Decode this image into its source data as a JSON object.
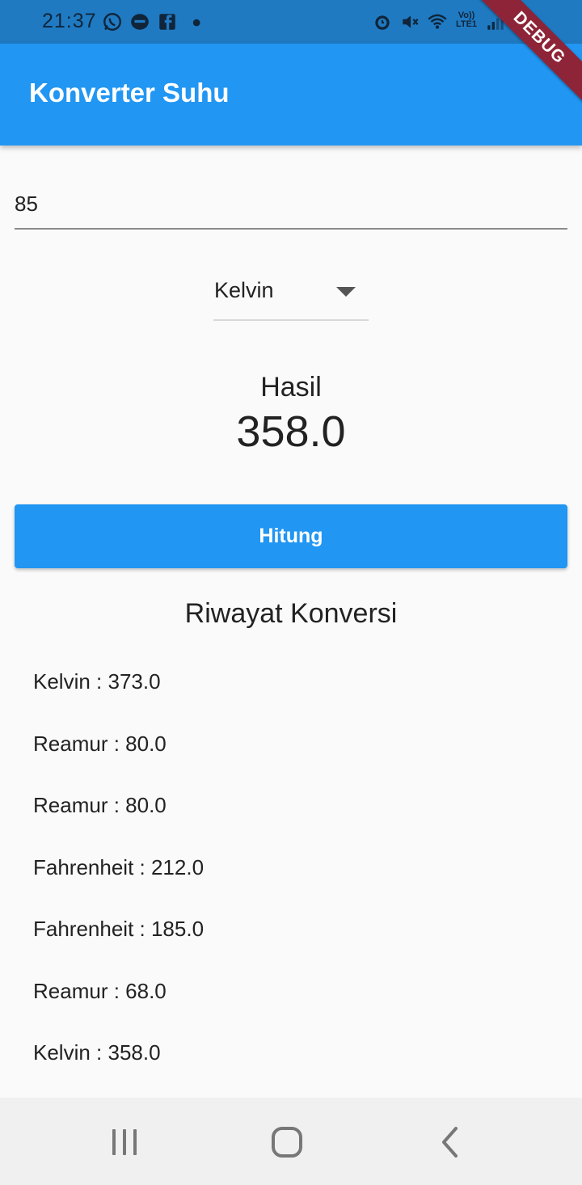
{
  "status_bar": {
    "time": "21:37",
    "left_icons": [
      "whatsapp-icon",
      "chat-bubble-icon",
      "facebook-icon",
      "dot-icon"
    ],
    "right_icons": [
      "alarm-icon",
      "mute-icon",
      "wifi-icon",
      "volte-icon",
      "signal-icon",
      "battery-icon"
    ],
    "volte_label_top": "Vo))",
    "volte_label_bottom": "LTE1"
  },
  "debug_banner": "DEBUG",
  "app_bar": {
    "title": "Konverter Suhu"
  },
  "input": {
    "value": "85"
  },
  "dropdown": {
    "selected": "Kelvin"
  },
  "result": {
    "label": "Hasil",
    "value": "358.0"
  },
  "button": {
    "label": "Hitung"
  },
  "history": {
    "title": "Riwayat Konversi",
    "items": [
      "Kelvin : 373.0",
      "Reamur : 80.0",
      "Reamur : 80.0",
      "Fahrenheit : 212.0",
      "Fahrenheit : 185.0",
      "Reamur : 68.0",
      "Kelvin : 358.0"
    ]
  },
  "nav_bar": {
    "items": [
      "recents-icon",
      "home-icon",
      "back-icon"
    ]
  },
  "colors": {
    "primary": "#2196f3",
    "status_bar": "#1f7ac2",
    "debug_banner": "#8e2437",
    "background": "#fafafa",
    "nav_bar": "#f0f0f0"
  }
}
